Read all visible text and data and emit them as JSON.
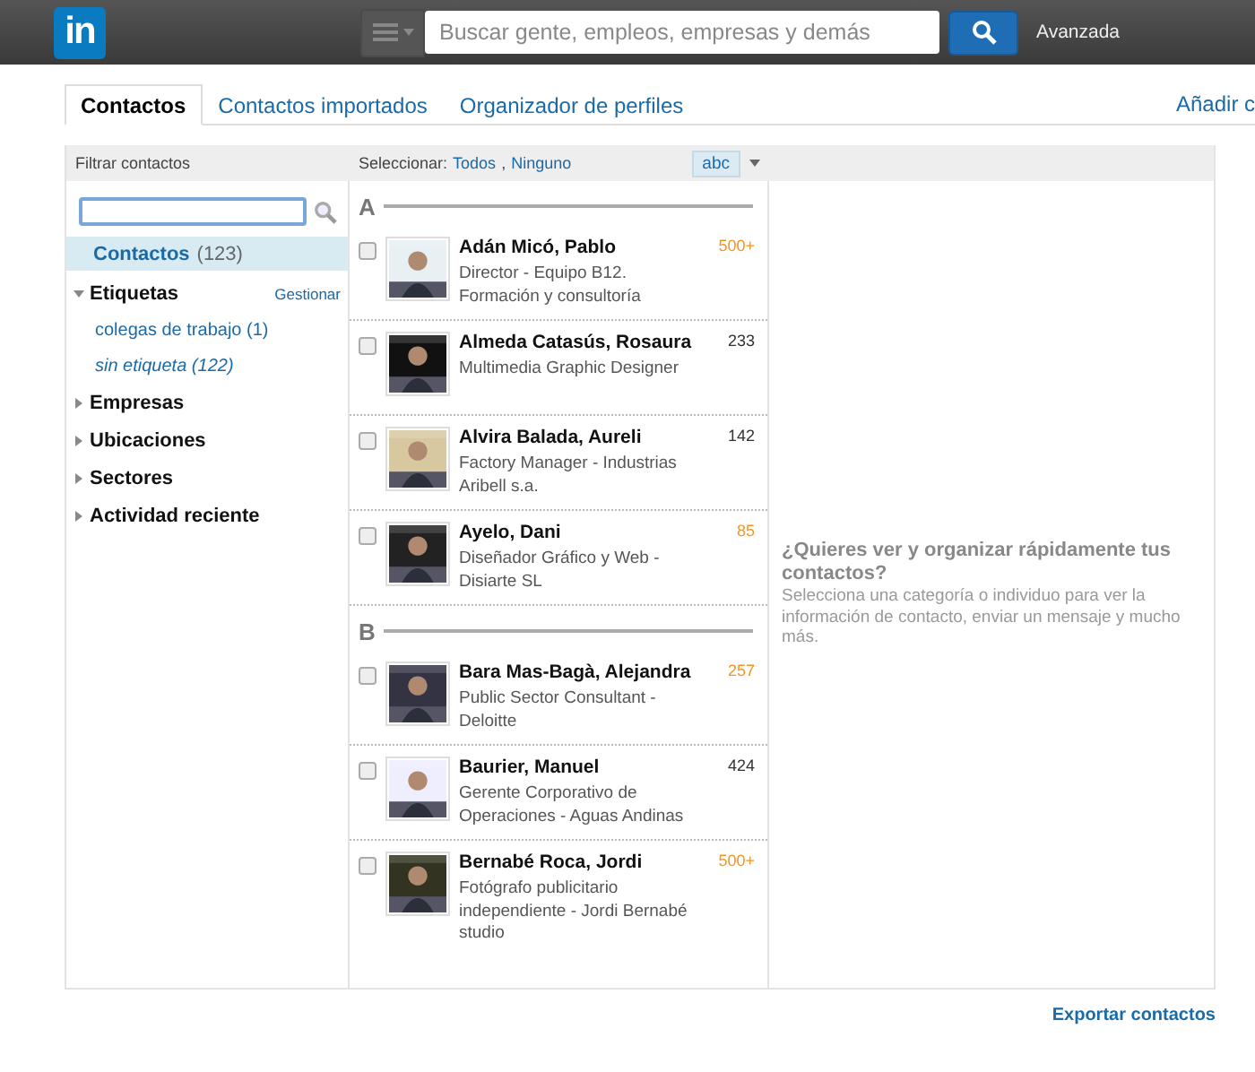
{
  "topbar": {
    "logo": "in",
    "search": {
      "placeholder": "Buscar gente, empleos, empresas y demás"
    },
    "advanced": "Avanzada"
  },
  "tabs": [
    {
      "label": "Contactos",
      "selected": true
    },
    {
      "label": "Contactos importados",
      "selected": false
    },
    {
      "label": "Organizador de perfiles",
      "selected": false
    }
  ],
  "add_link": "Añadir c",
  "filter": {
    "title": "Filtrar contactos",
    "all": {
      "label": "Contactos",
      "count": "(123)",
      "selected": true
    },
    "groups": [
      {
        "label": "Etiquetas",
        "expanded": true,
        "action": "Gestionar",
        "children": [
          {
            "label": "colegas de trabajo (1)",
            "kind": "tag"
          },
          {
            "label": "sin etiqueta (122)",
            "kind": "untagged"
          }
        ]
      },
      {
        "label": "Empresas",
        "expanded": false
      },
      {
        "label": "Ubicaciones",
        "expanded": false
      },
      {
        "label": "Sectores",
        "expanded": false
      },
      {
        "label": "Actividad reciente",
        "expanded": false
      }
    ]
  },
  "list_header": {
    "select_label": "Seleccionar:",
    "all": "Todos",
    "separator": ",",
    "none": "Ninguno",
    "sort": "abc"
  },
  "sections": [
    {
      "letter": "A",
      "contacts": [
        {
          "name": "Adán Micó, Pablo",
          "headline": "Director - Equipo B12. Formación y consultoría",
          "count": "500+",
          "color": "#f7941e",
          "checked": false
        },
        {
          "name": "Almeda Catasús, Rosaura",
          "headline": "Multimedia Graphic Designer",
          "count": "233",
          "color": "#333333",
          "checked": false
        },
        {
          "name": "Alvira Balada, Aureli",
          "headline": "Factory Manager - Industrias Aribell s.a.",
          "count": "142",
          "color": "#333333",
          "checked": false
        },
        {
          "name": "Ayelo, Dani",
          "headline": "Diseñador Gráfico y Web - Disiarte SL",
          "count": "85",
          "color": "#f7941e",
          "checked": false
        }
      ]
    },
    {
      "letter": "B",
      "contacts": [
        {
          "name": "Bara Mas-Bagà, Alejandra",
          "headline": "Public Sector Consultant - Deloitte",
          "count": "257",
          "color": "#f7941e",
          "checked": false
        },
        {
          "name": "Baurier, Manuel",
          "headline": "Gerente Corporativo de Operaciones - Aguas Andinas",
          "count": "424",
          "color": "#333333",
          "checked": false
        },
        {
          "name": "Bernabé Roca, Jordi",
          "headline": "Fotógrafo publicitario independiente - Jordi Bernabé studio",
          "count": "500+",
          "color": "#f7941e",
          "checked": false
        }
      ]
    }
  ],
  "detail": {
    "title": "¿Quieres ver y organizar rápidamente tus contactos?",
    "text": "Selecciona una categoría o individuo para ver la información de contacto, enviar un mensaje y mucho más."
  },
  "export_link": "Exportar contactos"
}
